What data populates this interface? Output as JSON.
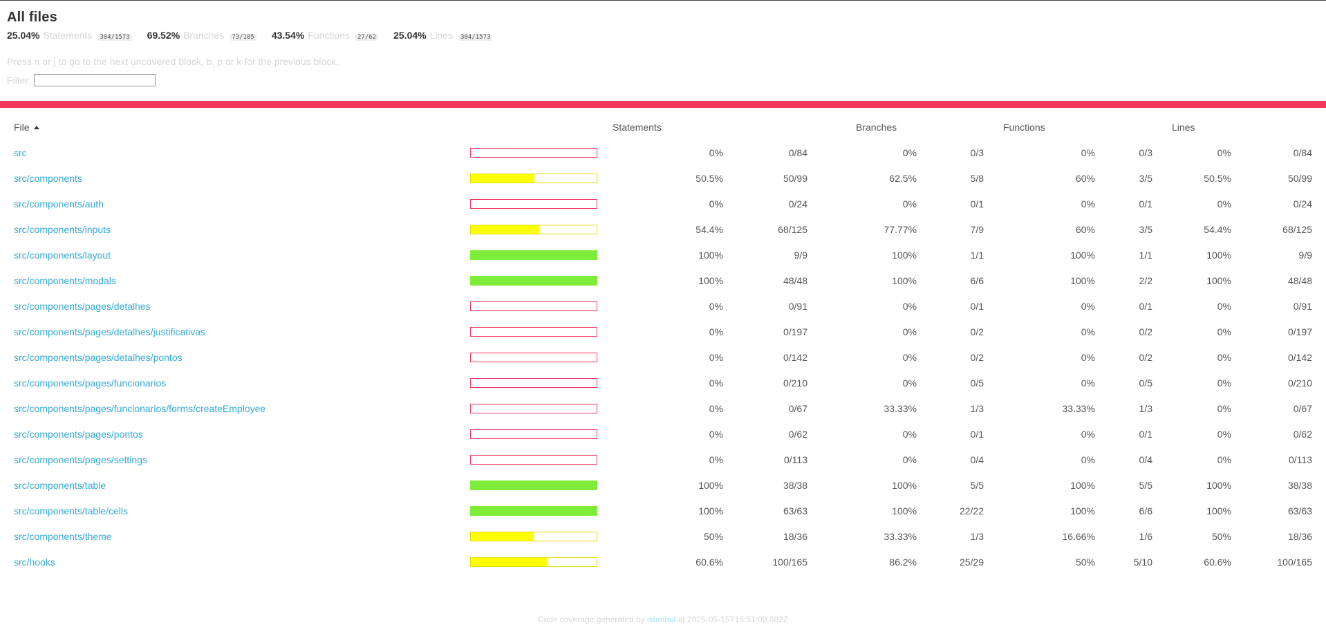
{
  "page": {
    "title": "All files"
  },
  "summary": [
    {
      "pct": "25.04%",
      "label": "Statements",
      "fraction": "304/1573"
    },
    {
      "pct": "69.52%",
      "label": "Branches",
      "fraction": "73/105"
    },
    {
      "pct": "43.54%",
      "label": "Functions",
      "fraction": "27/62"
    },
    {
      "pct": "25.04%",
      "label": "Lines",
      "fraction": "304/1573"
    }
  ],
  "hint": "Press n or j to go to the next uncovered block, b, p or k for the previous block.",
  "filter": {
    "label": "Filter:",
    "value": ""
  },
  "table": {
    "headers": {
      "file": "File",
      "statements": "Statements",
      "branches": "Branches",
      "functions": "Functions",
      "lines": "Lines"
    },
    "rows": [
      {
        "file": "src",
        "coverage": 0,
        "level": "low",
        "stmt_pct": "0%",
        "stmt_frac": "0/84",
        "br_pct": "0%",
        "br_frac": "0/3",
        "fn_pct": "0%",
        "fn_frac": "0/3",
        "ln_pct": "0%",
        "ln_frac": "0/84"
      },
      {
        "file": "src/components",
        "coverage": 50.5,
        "level": "medium",
        "stmt_pct": "50.5%",
        "stmt_frac": "50/99",
        "br_pct": "62.5%",
        "br_frac": "5/8",
        "fn_pct": "60%",
        "fn_frac": "3/5",
        "ln_pct": "50.5%",
        "ln_frac": "50/99"
      },
      {
        "file": "src/components/auth",
        "coverage": 0,
        "level": "low",
        "stmt_pct": "0%",
        "stmt_frac": "0/24",
        "br_pct": "0%",
        "br_frac": "0/1",
        "fn_pct": "0%",
        "fn_frac": "0/1",
        "ln_pct": "0%",
        "ln_frac": "0/24"
      },
      {
        "file": "src/components/inputs",
        "coverage": 54.4,
        "level": "medium",
        "stmt_pct": "54.4%",
        "stmt_frac": "68/125",
        "br_pct": "77.77%",
        "br_frac": "7/9",
        "fn_pct": "60%",
        "fn_frac": "3/5",
        "ln_pct": "54.4%",
        "ln_frac": "68/125"
      },
      {
        "file": "src/components/layout",
        "coverage": 100,
        "level": "high",
        "stmt_pct": "100%",
        "stmt_frac": "9/9",
        "br_pct": "100%",
        "br_frac": "1/1",
        "fn_pct": "100%",
        "fn_frac": "1/1",
        "ln_pct": "100%",
        "ln_frac": "9/9"
      },
      {
        "file": "src/components/modals",
        "coverage": 100,
        "level": "high",
        "stmt_pct": "100%",
        "stmt_frac": "48/48",
        "br_pct": "100%",
        "br_frac": "6/6",
        "fn_pct": "100%",
        "fn_frac": "2/2",
        "ln_pct": "100%",
        "ln_frac": "48/48"
      },
      {
        "file": "src/components/pages/detalhes",
        "coverage": 0,
        "level": "low",
        "stmt_pct": "0%",
        "stmt_frac": "0/91",
        "br_pct": "0%",
        "br_frac": "0/1",
        "fn_pct": "0%",
        "fn_frac": "0/1",
        "ln_pct": "0%",
        "ln_frac": "0/91"
      },
      {
        "file": "src/components/pages/detalhes/justificativas",
        "coverage": 0,
        "level": "low",
        "stmt_pct": "0%",
        "stmt_frac": "0/197",
        "br_pct": "0%",
        "br_frac": "0/2",
        "fn_pct": "0%",
        "fn_frac": "0/2",
        "ln_pct": "0%",
        "ln_frac": "0/197"
      },
      {
        "file": "src/components/pages/detalhes/pontos",
        "coverage": 0,
        "level": "low",
        "stmt_pct": "0%",
        "stmt_frac": "0/142",
        "br_pct": "0%",
        "br_frac": "0/2",
        "fn_pct": "0%",
        "fn_frac": "0/2",
        "ln_pct": "0%",
        "ln_frac": "0/142"
      },
      {
        "file": "src/components/pages/funcionarios",
        "coverage": 0,
        "level": "low",
        "stmt_pct": "0%",
        "stmt_frac": "0/210",
        "br_pct": "0%",
        "br_frac": "0/5",
        "fn_pct": "0%",
        "fn_frac": "0/5",
        "ln_pct": "0%",
        "ln_frac": "0/210"
      },
      {
        "file": "src/components/pages/funcionarios/forms/createEmployee",
        "coverage": 0,
        "level": "low",
        "stmt_pct": "0%",
        "stmt_frac": "0/67",
        "br_pct": "33.33%",
        "br_frac": "1/3",
        "fn_pct": "33.33%",
        "fn_frac": "1/3",
        "ln_pct": "0%",
        "ln_frac": "0/67"
      },
      {
        "file": "src/components/pages/pontos",
        "coverage": 0,
        "level": "low",
        "stmt_pct": "0%",
        "stmt_frac": "0/62",
        "br_pct": "0%",
        "br_frac": "0/1",
        "fn_pct": "0%",
        "fn_frac": "0/1",
        "ln_pct": "0%",
        "ln_frac": "0/62"
      },
      {
        "file": "src/components/pages/settings",
        "coverage": 0,
        "level": "low",
        "stmt_pct": "0%",
        "stmt_frac": "0/113",
        "br_pct": "0%",
        "br_frac": "0/4",
        "fn_pct": "0%",
        "fn_frac": "0/4",
        "ln_pct": "0%",
        "ln_frac": "0/113"
      },
      {
        "file": "src/components/table",
        "coverage": 100,
        "level": "high",
        "stmt_pct": "100%",
        "stmt_frac": "38/38",
        "br_pct": "100%",
        "br_frac": "5/5",
        "fn_pct": "100%",
        "fn_frac": "5/5",
        "ln_pct": "100%",
        "ln_frac": "38/38"
      },
      {
        "file": "src/components/table/cells",
        "coverage": 100,
        "level": "high",
        "stmt_pct": "100%",
        "stmt_frac": "63/63",
        "br_pct": "100%",
        "br_frac": "22/22",
        "fn_pct": "100%",
        "fn_frac": "6/6",
        "ln_pct": "100%",
        "ln_frac": "63/63"
      },
      {
        "file": "src/components/theme",
        "coverage": 50,
        "level": "medium",
        "stmt_pct": "50%",
        "stmt_frac": "18/36",
        "br_pct": "33.33%",
        "br_frac": "1/3",
        "fn_pct": "16.66%",
        "fn_frac": "1/6",
        "ln_pct": "50%",
        "ln_frac": "18/36"
      },
      {
        "file": "src/hooks",
        "coverage": 60.6,
        "level": "medium",
        "stmt_pct": "60.6%",
        "stmt_frac": "100/165",
        "br_pct": "86.2%",
        "br_frac": "25/29",
        "fn_pct": "50%",
        "fn_frac": "5/10",
        "ln_pct": "60.6%",
        "ln_frac": "100/165"
      }
    ]
  },
  "colors": {
    "low": "#f1365e",
    "medium": "#ffff00",
    "medium_border": "#e6d800",
    "high": "#7fec3a",
    "high_border": "#7fec3a",
    "link": "#31a9d9"
  },
  "footer": {
    "prefix": "Code coverage generated by",
    "tool": "istanbul",
    "suffix": "at 2025-05-15T15:51:09.882Z"
  }
}
